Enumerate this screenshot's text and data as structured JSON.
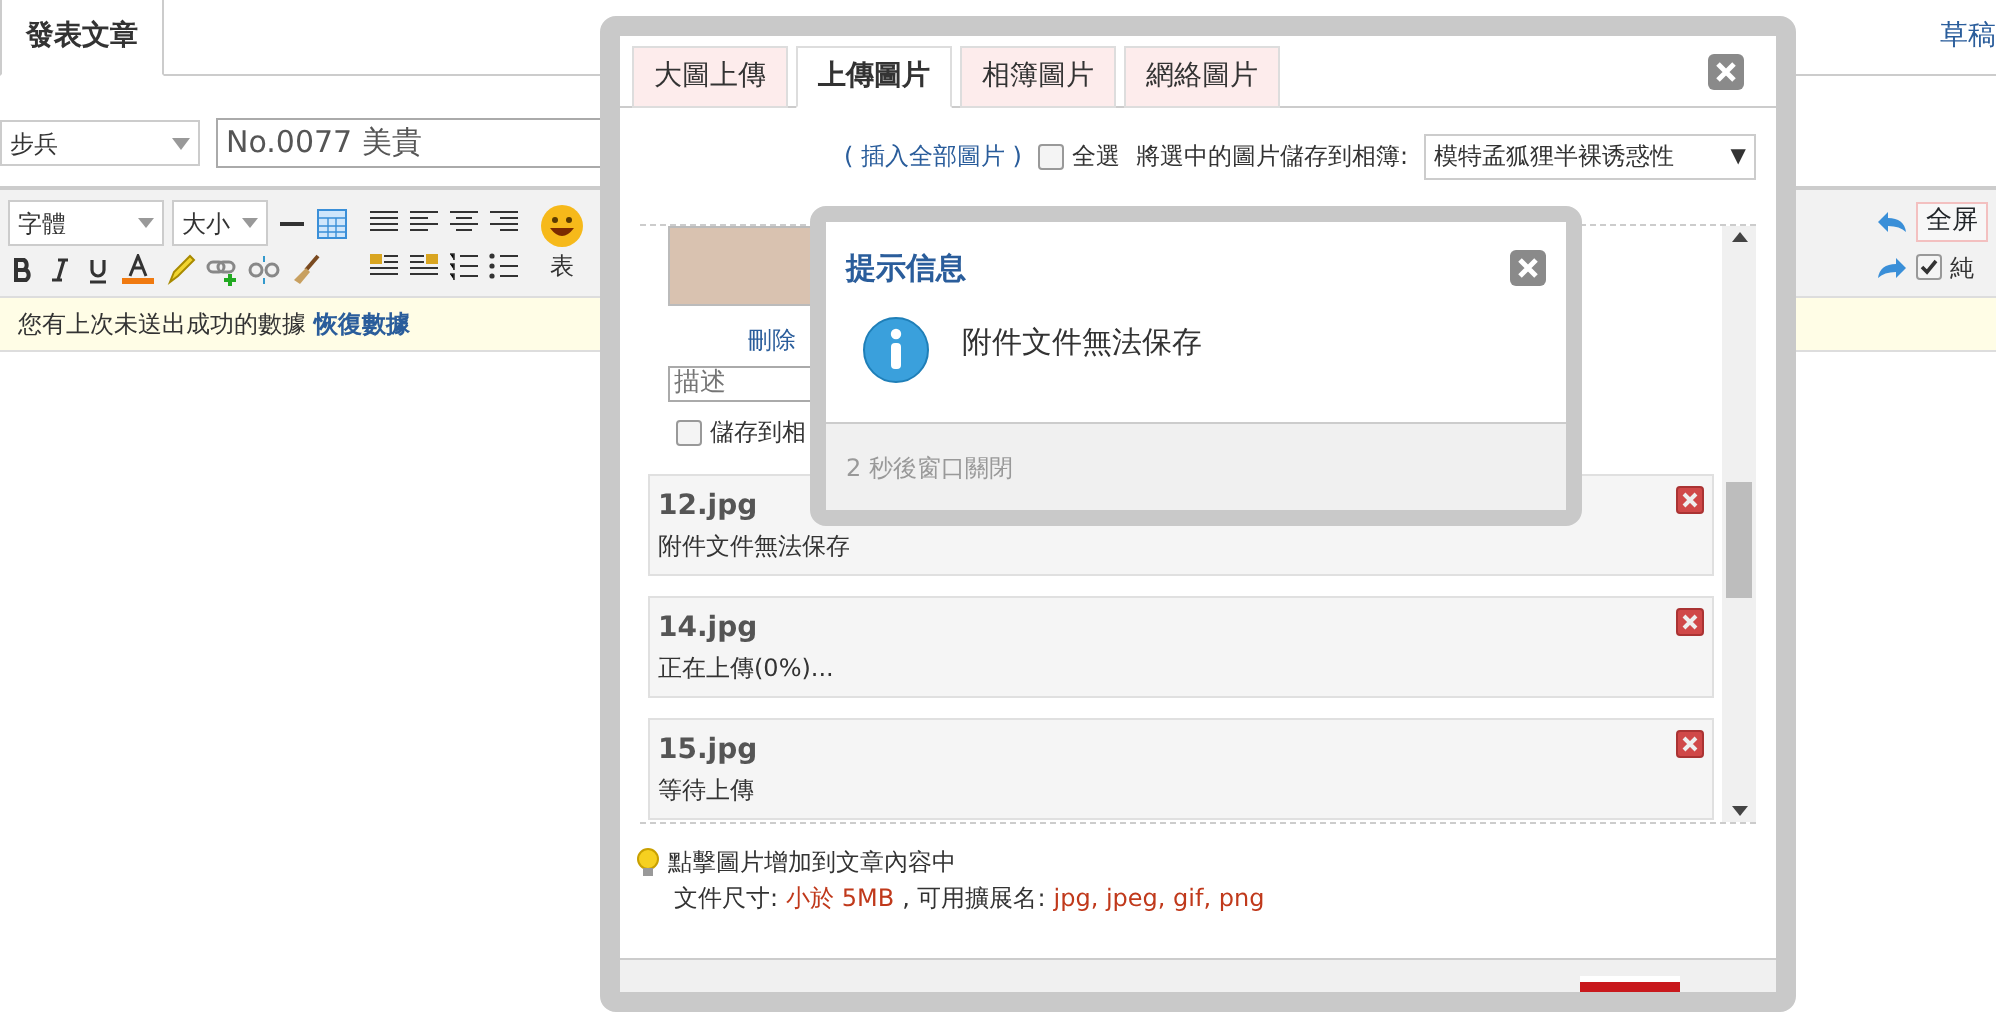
{
  "page": {
    "tabs": [
      {
        "label": "發表文章",
        "selected": true
      }
    ],
    "drafts_link": "草稿",
    "category": "步兵",
    "title_value": "No.0077 美貴",
    "font_select": "字體",
    "size_select": "大小",
    "emoji_label": "表",
    "fullscreen": "全屏",
    "plain_text": {
      "label": "純",
      "checked": true
    },
    "notice": {
      "text": "您有上次未送出成功的數據",
      "link": "恢復數據"
    }
  },
  "upload_dialog": {
    "tabs": [
      {
        "label": "大圖上傳",
        "selected": false
      },
      {
        "label": "上傳圖片",
        "selected": true
      },
      {
        "label": "相簿圖片",
        "selected": false
      },
      {
        "label": "網絡圖片",
        "selected": false
      }
    ],
    "insert_all": "( 插入全部圖片 )",
    "select_all": {
      "label": "全選",
      "checked": false
    },
    "save_label": "將選中的圖片儲存到相簿:",
    "album": "模特孟狐狸半裸诱惑性",
    "album_arrow": "▼",
    "image_item": {
      "delete": "刪除",
      "description_placeholder": "描述",
      "save_to_album": {
        "label": "儲存到相",
        "checked": false
      }
    },
    "files": [
      {
        "name": "12.jpg",
        "status": "附件文件無法保存"
      },
      {
        "name": "14.jpg",
        "status": "正在上傳(0%)..."
      },
      {
        "name": "15.jpg",
        "status": "等待上傳"
      }
    ],
    "hint": "點擊圖片增加到文章內容中",
    "size_label": "文件尺寸:",
    "size_value": "小於 5MB",
    "ext_label": ", 可用擴展名:",
    "ext_value": "jpg, jpeg, gif, png"
  },
  "alert": {
    "title": "提示信息",
    "message": "附件文件無法保存",
    "footer": "2 秒後窗口關閉"
  }
}
